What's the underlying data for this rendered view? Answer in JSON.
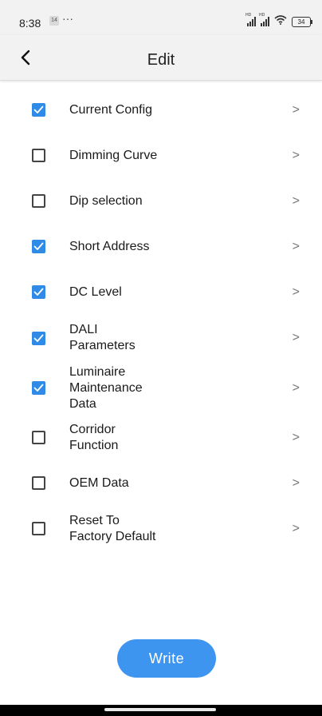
{
  "status_bar": {
    "time": "8:38",
    "msg_badge": "14",
    "dots": "···",
    "battery": "34",
    "signal_label": "HD"
  },
  "header": {
    "title": "Edit",
    "back_icon": "chevron-left-icon"
  },
  "items": [
    {
      "label": "Current Config",
      "checked": true
    },
    {
      "label": "Dimming Curve",
      "checked": false
    },
    {
      "label": "Dip selection",
      "checked": false
    },
    {
      "label": "Short Address",
      "checked": true
    },
    {
      "label": "DC Level",
      "checked": true
    },
    {
      "label": "DALI\nParameters",
      "checked": true
    },
    {
      "label": "Luminaire\nMaintenance\nData",
      "checked": true
    },
    {
      "label": "Corridor\nFunction",
      "checked": false
    },
    {
      "label": "OEM Data",
      "checked": false
    },
    {
      "label": "Reset To\nFactory Default",
      "checked": false
    }
  ],
  "chevron_glyph": ">",
  "write_button": {
    "label": "Write"
  },
  "colors": {
    "accent": "#2f8be6",
    "button": "#3d95ef",
    "bar_background": "#f2f2f2"
  }
}
